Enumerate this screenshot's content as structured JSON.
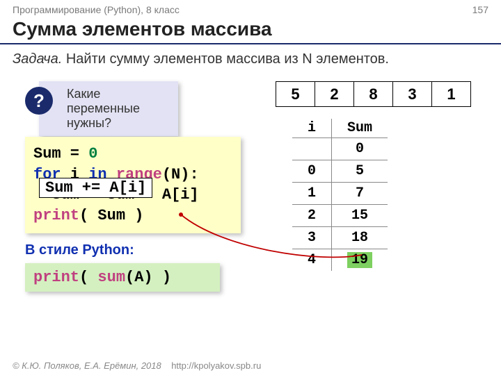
{
  "header": {
    "course": "Программирование (Python), 8 класс",
    "page": "157"
  },
  "title": "Сумма элементов массива",
  "task": {
    "label": "Задача.",
    "text": " Найти сумму элементов массива из N элементов."
  },
  "question": {
    "mark": "?",
    "text": "Какие переменные нужны?"
  },
  "code": {
    "l1a": "Sum = ",
    "l1b": "0",
    "l2a": "for",
    "l2b": " i ",
    "l2c": "in",
    "l2d": " ",
    "l2e": "range",
    "l2f": "(N):",
    "l3": "  Sum = Sum + A[i]",
    "patch": "Sum += A[i]",
    "l4a": "print",
    "l4b": "( Sum )"
  },
  "pystyle": {
    "label": "В стиле Python:",
    "code_a": "print",
    "code_b": "( ",
    "code_c": "sum",
    "code_d": "(A) )"
  },
  "array": [
    "5",
    "2",
    "8",
    "3",
    "1"
  ],
  "trace": {
    "head_i": "i",
    "head_sum": "Sum",
    "rows": [
      {
        "i": "",
        "sum": "0"
      },
      {
        "i": "0",
        "sum": "5"
      },
      {
        "i": "1",
        "sum": "7"
      },
      {
        "i": "2",
        "sum": "15"
      },
      {
        "i": "3",
        "sum": "18"
      },
      {
        "i": "4",
        "sum": "19"
      }
    ]
  },
  "footer": {
    "authors": "© К.Ю. Поляков, Е.А. Ерёмин, 2018",
    "url": "http://kpolyakov.spb.ru"
  }
}
